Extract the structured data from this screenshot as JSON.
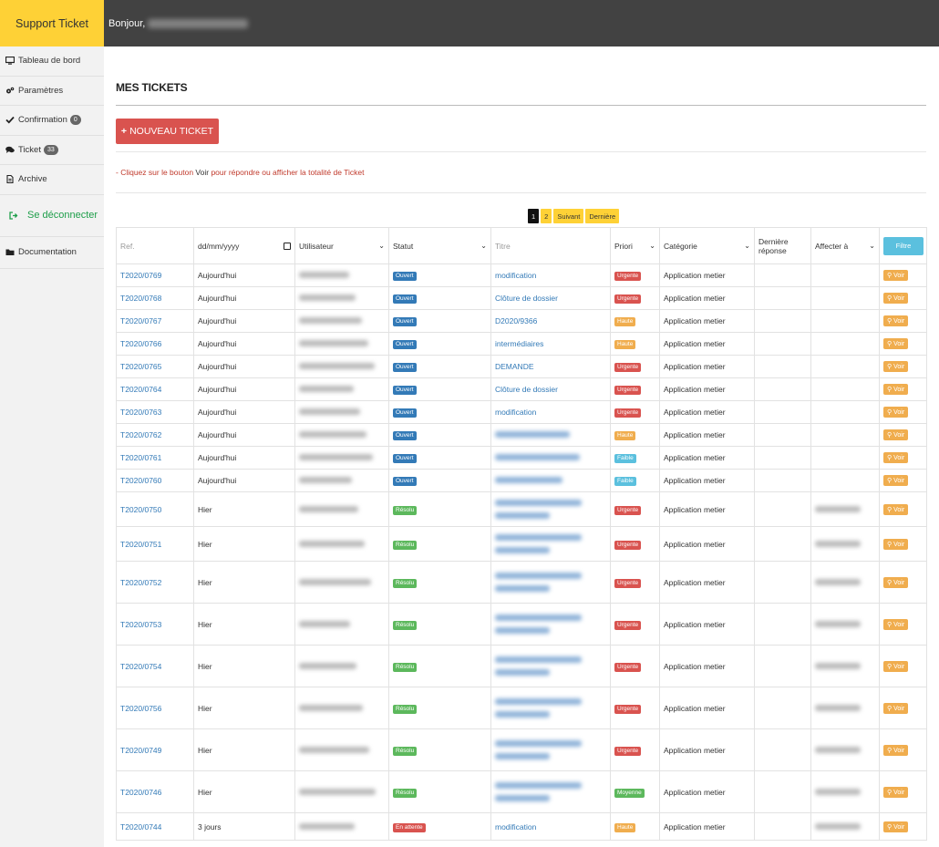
{
  "sidebar": {
    "brand": "Support Ticket",
    "items": [
      {
        "label": "Tableau de bord",
        "icon": "monitor-icon"
      },
      {
        "label": "Paramètres",
        "icon": "cogs-icon"
      },
      {
        "label": "Confirmation",
        "icon": "check-icon",
        "badge": "0"
      },
      {
        "label": "Ticket",
        "icon": "comments-icon",
        "badge": "33"
      },
      {
        "label": "Archive",
        "icon": "file-icon"
      }
    ],
    "logout": {
      "label": "Se déconnecter",
      "icon": "sign-out-icon"
    },
    "doc": {
      "label": "Documentation",
      "icon": "folder-icon"
    }
  },
  "topbar": {
    "greeting": "Bonjour,"
  },
  "main": {
    "title": "MES TICKETS",
    "new_ticket": "NOUVEAU TICKET",
    "hint_prefix": "- Cliquez sur le bouton",
    "hint_bold": "Voir",
    "hint_suffix": "pour répondre ou afficher la totalité de Ticket"
  },
  "pagination": [
    "1",
    "2",
    "Suivant",
    "Dernière"
  ],
  "table": {
    "headers": {
      "ref": "Ref.",
      "date_placeholder": "dd/mm/yyyy",
      "user": "Utilisateur",
      "status": "Statut",
      "title": "Titre",
      "priority": "Priori",
      "category": "Catégorie",
      "last_reply": "Dernière réponse",
      "assign": "Affecter à",
      "filter": "Filtre"
    },
    "action_label": "Voir",
    "rows": [
      {
        "ref": "T2020/0769",
        "date": "Aujourd'hui",
        "status": "Ouvert",
        "title": "modification",
        "priority": "Urgente",
        "category": "Application metier"
      },
      {
        "ref": "T2020/0768",
        "date": "Aujourd'hui",
        "status": "Ouvert",
        "title": "Clôture de dossier",
        "priority": "Urgente",
        "category": "Application metier"
      },
      {
        "ref": "T2020/0767",
        "date": "Aujourd'hui",
        "status": "Ouvert",
        "title": "D2020/9366",
        "priority": "Haute",
        "category": "Application metier"
      },
      {
        "ref": "T2020/0766",
        "date": "Aujourd'hui",
        "status": "Ouvert",
        "title": "intermédiaires",
        "priority": "Haute",
        "category": "Application metier"
      },
      {
        "ref": "T2020/0765",
        "date": "Aujourd'hui",
        "status": "Ouvert",
        "title": "DEMANDE",
        "priority": "Urgente",
        "category": "Application metier"
      },
      {
        "ref": "T2020/0764",
        "date": "Aujourd'hui",
        "status": "Ouvert",
        "title": "Clôture de dossier",
        "priority": "Urgente",
        "category": "Application metier"
      },
      {
        "ref": "T2020/0763",
        "date": "Aujourd'hui",
        "status": "Ouvert",
        "title": "modification",
        "priority": "Urgente",
        "category": "Application metier"
      },
      {
        "ref": "T2020/0762",
        "date": "Aujourd'hui",
        "status": "Ouvert",
        "title": "",
        "priority": "Haute",
        "category": "Application metier"
      },
      {
        "ref": "T2020/0761",
        "date": "Aujourd'hui",
        "status": "Ouvert",
        "title": "",
        "priority": "Faible",
        "category": "Application metier"
      },
      {
        "ref": "T2020/0760",
        "date": "Aujourd'hui",
        "status": "Ouvert",
        "title": "",
        "priority": "Faible",
        "category": "Application metier"
      },
      {
        "ref": "T2020/0750",
        "date": "Hier",
        "status": "Résolu",
        "title": "",
        "priority": "Urgente",
        "category": "Application metier"
      },
      {
        "ref": "T2020/0751",
        "date": "Hier",
        "status": "Résolu",
        "title": "",
        "priority": "Urgente",
        "category": "Application metier"
      },
      {
        "ref": "T2020/0752",
        "date": "Hier",
        "status": "Résolu",
        "title": "",
        "priority": "Urgente",
        "category": "Application metier"
      },
      {
        "ref": "T2020/0753",
        "date": "Hier",
        "status": "Résolu",
        "title": "",
        "priority": "Urgente",
        "category": "Application metier"
      },
      {
        "ref": "T2020/0754",
        "date": "Hier",
        "status": "Résolu",
        "title": "",
        "priority": "Urgente",
        "category": "Application metier"
      },
      {
        "ref": "T2020/0756",
        "date": "Hier",
        "status": "Résolu",
        "title": "",
        "priority": "Urgente",
        "category": "Application metier"
      },
      {
        "ref": "T2020/0749",
        "date": "Hier",
        "status": "Résolu",
        "title": "",
        "priority": "Urgente",
        "category": "Application metier"
      },
      {
        "ref": "T2020/0746",
        "date": "Hier",
        "status": "Résolu",
        "title": "",
        "priority": "Moyenne",
        "category": "Application metier"
      },
      {
        "ref": "T2020/0744",
        "date": "3 jours",
        "status": "En attente",
        "title": "modification",
        "priority": "Haute",
        "category": "Application metier"
      }
    ]
  },
  "colors": {
    "brand_yellow": "#fed136",
    "topbar": "#424242",
    "link_blue": "#337ab7",
    "danger": "#d9534f",
    "success": "#5cb85c",
    "warning": "#f0ad4e",
    "info": "#5bc0de",
    "logout_green": "#1e9e4a"
  }
}
